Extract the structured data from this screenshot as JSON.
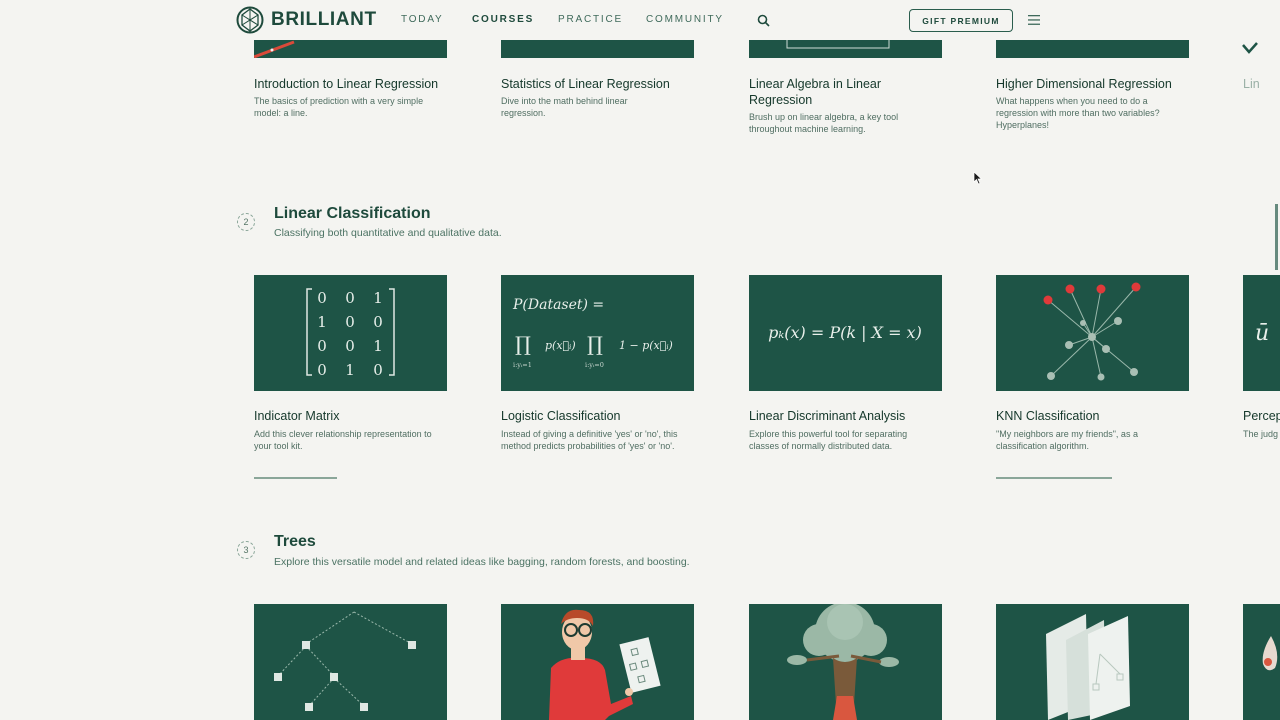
{
  "nav": {
    "brand": "BRILLIANT",
    "links": [
      "TODAY",
      "COURSES",
      "PRACTICE",
      "COMMUNITY"
    ],
    "active": "COURSES",
    "gift_label": "GIFT PREMIUM",
    "icons": [
      "search-icon",
      "menu-icon"
    ]
  },
  "top_row": [
    {
      "title": "Introduction to Linear Regression",
      "desc": "The basics of prediction with a very simple model: a line."
    },
    {
      "title": "Statistics of Linear Regression",
      "desc": "Dive into the math behind linear regression."
    },
    {
      "title": "Linear Algebra in Linear Regression",
      "desc": "Brush up on linear algebra, a key tool throughout machine learning."
    },
    {
      "title": "Higher Dimensional Regression",
      "desc": "What happens when you need to do a regression with more than two variables? Hyperplanes!"
    },
    {
      "title": "Lin"
    }
  ],
  "sections": [
    {
      "number": "2",
      "title": "Linear Classification",
      "desc": "Classifying both quantitative and qualitative data.",
      "courses": [
        {
          "title": "Indicator Matrix",
          "desc": "Add this clever relationship representation to your tool kit."
        },
        {
          "title": "Logistic Classification",
          "desc": "Instead of giving a definitive 'yes' or 'no', this method predicts probabilities of 'yes' or 'no'."
        },
        {
          "title": "Linear Discriminant Analysis",
          "desc": "Explore this powerful tool for separating classes of normally distributed data."
        },
        {
          "title": "KNN Classification",
          "desc": "\"My neighbors are my friends\", as a classification algorithm."
        },
        {
          "title": "Percep",
          "desc": "The judg"
        }
      ],
      "progress": [
        0.43,
        0.6
      ]
    },
    {
      "number": "3",
      "title": "Trees",
      "desc": "Explore this versatile model and related ideas like bagging, random forests, and boosting."
    }
  ],
  "math": {
    "matrix": [
      [
        "0",
        "0",
        "1"
      ],
      [
        "1",
        "0",
        "0"
      ],
      [
        "0",
        "0",
        "1"
      ],
      [
        "0",
        "1",
        "0"
      ]
    ],
    "logistic_line1": "P(Dataset) =",
    "logistic_prod1": "∏",
    "logistic_term1": "p(x⃗ᵢ)",
    "logistic_prod2": "∏",
    "logistic_term2": "1 − p(x⃗ᵢ)",
    "logistic_sub1": "i:yᵢ=1",
    "logistic_sub2": "i:yᵢ=0",
    "lda": "pₖ(x) = P(k | X = x)",
    "percep_glyph": "ū"
  },
  "colors": {
    "brand_green": "#1e5446",
    "text_dark": "#15382b",
    "red_point": "#e03a3a",
    "bg": "#f4f4f1"
  }
}
